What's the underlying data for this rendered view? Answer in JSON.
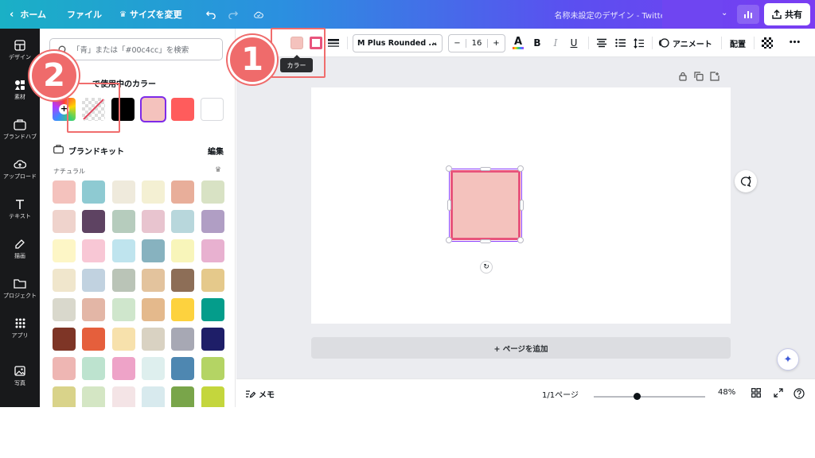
{
  "topbar": {
    "home_label": "ホーム",
    "file_label": "ファイル",
    "resize_label": "サイズを変更",
    "doc_title": "名称未設定のデザイン - Twitter",
    "share_label": "共有"
  },
  "rail": {
    "items": [
      {
        "label": "デザイン",
        "icon": "layout-icon"
      },
      {
        "label": "素材",
        "icon": "elements-icon"
      },
      {
        "label": "ブランドハブ",
        "icon": "brand-icon"
      },
      {
        "label": "アップロード",
        "icon": "upload-icon"
      },
      {
        "label": "テキスト",
        "icon": "text-icon"
      },
      {
        "label": "描画",
        "icon": "draw-icon"
      },
      {
        "label": "プロジェクト",
        "icon": "folder-icon"
      },
      {
        "label": "アプリ",
        "icon": "apps-icon"
      },
      {
        "label": "写真",
        "icon": "photo-icon"
      }
    ]
  },
  "panel": {
    "search_placeholder": "「青」または「#00c4cc」を検索",
    "doc_colors_title": "で使用中のカラー",
    "doc_colors": [
      "#000000",
      "#f4c2bd",
      "#ff5c5c",
      "#ffffff"
    ],
    "brand_kit_title": "ブランドキット",
    "brand_edit_label": "編集",
    "palette_name": "ナチュラル",
    "palette": [
      [
        "#f4c2bd",
        "#8ecad2",
        "#efeadc",
        "#f4f0d3",
        "#e8ae9a",
        "#d8e2c4"
      ],
      [
        "#efd3cc",
        "#5e4362",
        "#b6ccbd",
        "#e8c4cf",
        "#b8d7dc",
        "#b09ec4"
      ],
      [
        "#fdf6c6",
        "#f8c7d5",
        "#bfe4ee",
        "#87b2bf",
        "#f8f5ba",
        "#e8b1d0"
      ],
      [
        "#f0e6cc",
        "#c1d2e0",
        "#bac4b7",
        "#e3c39d",
        "#8d6e57",
        "#e5c98b"
      ],
      [
        "#d9d8cc",
        "#e3b6a6",
        "#cfe6cc",
        "#e4b98c",
        "#fdd23e",
        "#049d8b"
      ],
      [
        "#7e3526",
        "#e55f3c",
        "#f7e1ac",
        "#d9d2c2",
        "#a7a8b4",
        "#1e1e68"
      ],
      [
        "#eeb6b3",
        "#bde3cf",
        "#eea3c8",
        "#deefee",
        "#4e87b1",
        "#b4d464"
      ],
      [
        "#d9d38a",
        "#d4e6c4",
        "#f4e4e6",
        "#d8eaee",
        "#79a54a",
        "#c4d63d"
      ]
    ]
  },
  "toolbar": {
    "fill_color": "#f4c2bd",
    "border_color": "#e8547c",
    "font_name": "M Plus Rounded ...",
    "font_size": "16",
    "minus": "−",
    "plus": "+",
    "bold": "B",
    "italic": "I",
    "underline": "U",
    "animate_label": "アニメート",
    "position_label": "配置",
    "more": "•••",
    "tooltip": "カラー"
  },
  "canvas": {
    "add_page_label": "+ ページを追加",
    "shape_fill": "#f4c2bd",
    "shape_border": "#e8547c"
  },
  "footer": {
    "notes_label": "メモ",
    "page_counter": "1/1ページ",
    "zoom_level": "48%",
    "zoom_fraction": 0.38
  },
  "annotations": {
    "badge1": "1",
    "badge2": "2"
  }
}
